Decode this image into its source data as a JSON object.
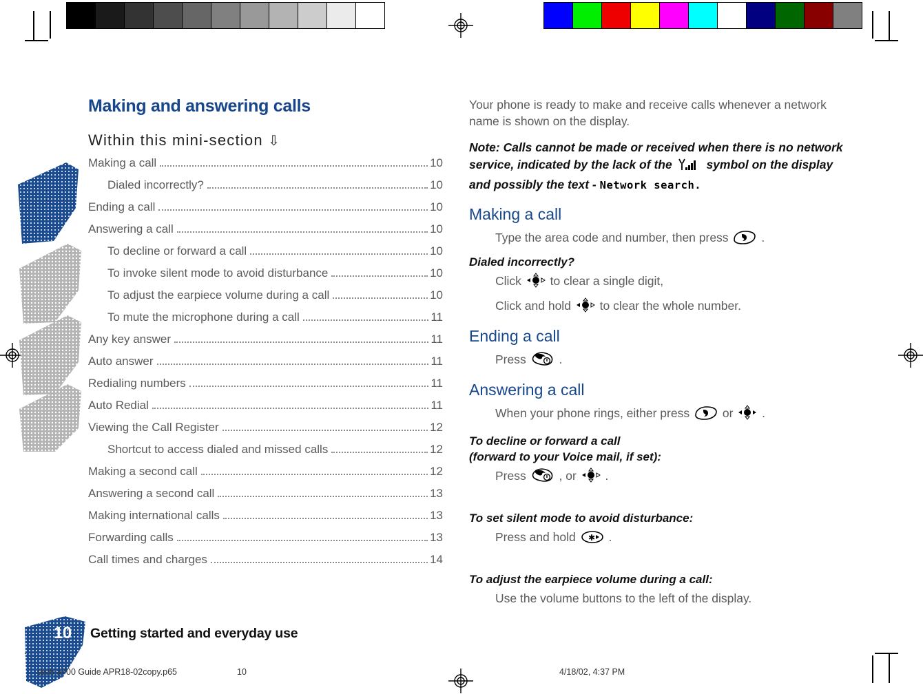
{
  "print_marks": {
    "grayscale_swatches": [
      "#000000",
      "#1a1a1a",
      "#333333",
      "#4d4d4d",
      "#666666",
      "#808080",
      "#999999",
      "#b3b3b3",
      "#cccccc",
      "#ebebeb",
      "#ffffff"
    ],
    "color_swatches": [
      "#0000ff",
      "#00ee00",
      "#ee0000",
      "#ffff00",
      "#ff00ff",
      "#00ffff",
      "#ffffff",
      "#000080",
      "#006600",
      "#880000",
      "#808080"
    ]
  },
  "left": {
    "section_title": "Making and answering calls",
    "mini_section_label": "Within this mini-section",
    "mini_section_arrow": "⇩",
    "toc": [
      {
        "label": "Making a call",
        "page": "10",
        "level": 1
      },
      {
        "label": "Dialed incorrectly?",
        "page": "10",
        "level": 2
      },
      {
        "label": "Ending a call",
        "page": "10",
        "level": 1
      },
      {
        "label": "Answering a call",
        "page": "10",
        "level": 1
      },
      {
        "label": "To decline or forward a call",
        "page": "10",
        "level": 2
      },
      {
        "label": "To invoke silent mode to avoid disturbance",
        "page": "10",
        "level": 2
      },
      {
        "label": "To adjust the earpiece volume during a call",
        "page": "10",
        "level": 2
      },
      {
        "label": "To mute the microphone during a call",
        "page": "11",
        "level": 2
      },
      {
        "label": "Any key answer",
        "page": "11",
        "level": 1
      },
      {
        "label": "Auto answer",
        "page": "11",
        "level": 1
      },
      {
        "label": "Redialing numbers",
        "page": "11",
        "level": 1
      },
      {
        "label": "Auto Redial",
        "page": "11",
        "level": 1
      },
      {
        "label": "Viewing the Call Register",
        "page": "12",
        "level": 1
      },
      {
        "label": "Shortcut to access dialed and missed calls",
        "page": "12",
        "level": 2
      },
      {
        "label": "Making a second call",
        "page": "12",
        "level": 1
      },
      {
        "label": "Answering a second call",
        "page": "13",
        "level": 1
      },
      {
        "label": "Making international calls",
        "page": "13",
        "level": 1
      },
      {
        "label": "Forwarding calls",
        "page": "13",
        "level": 1
      },
      {
        "label": "Call times and charges",
        "page": "14",
        "level": 1
      }
    ]
  },
  "right": {
    "intro": "Your phone is ready to make and receive calls whenever a network name is shown on the display.",
    "note_part1": "Note: Calls cannot be made or received when there is no network service, indicated by the lack of the",
    "note_part2": "symbol on the display and possibly the text -",
    "note_lcd": "Network search.",
    "making_a_call": {
      "heading": "Making a call",
      "step_before": "Type the area code and number, then press",
      "step_after": "."
    },
    "dialed_incorrectly": {
      "heading": "Dialed incorrectly?",
      "line1_before": "Click",
      "line1_after": "to clear a single digit,",
      "line2_before": "Click and hold",
      "line2_after": "to clear the whole number."
    },
    "ending_a_call": {
      "heading": "Ending a call",
      "step_before": "Press",
      "step_after": "."
    },
    "answering_a_call": {
      "heading": "Answering a call",
      "step_before": "When your phone rings, either press",
      "step_middle": "or",
      "step_after": "."
    },
    "decline_forward": {
      "heading_line1": "To decline or forward a call",
      "heading_line2": "(forward to your Voice mail, if set):",
      "step_before": "Press",
      "step_middle": ", or",
      "step_after": "."
    },
    "silent_mode": {
      "heading": "To set silent mode to avoid disturbance:",
      "step_before": "Press and hold",
      "step_after": "."
    },
    "earpiece_volume": {
      "heading": "To adjust the earpiece volume during a call:",
      "step": "Use the volume buttons to the left of the display."
    }
  },
  "footer": {
    "page_number": "10",
    "title": "Getting started and everyday use",
    "print_file": "tech a700 Guide APR18-02copy.p65",
    "print_page": "10",
    "print_date": "4/18/02, 4:37 PM"
  },
  "colors": {
    "heading_blue": "#17478a",
    "blob_blue": "#1b4c8f",
    "leaf_gray": "#b0b0b0",
    "body_gray": "#5b5b5b"
  }
}
